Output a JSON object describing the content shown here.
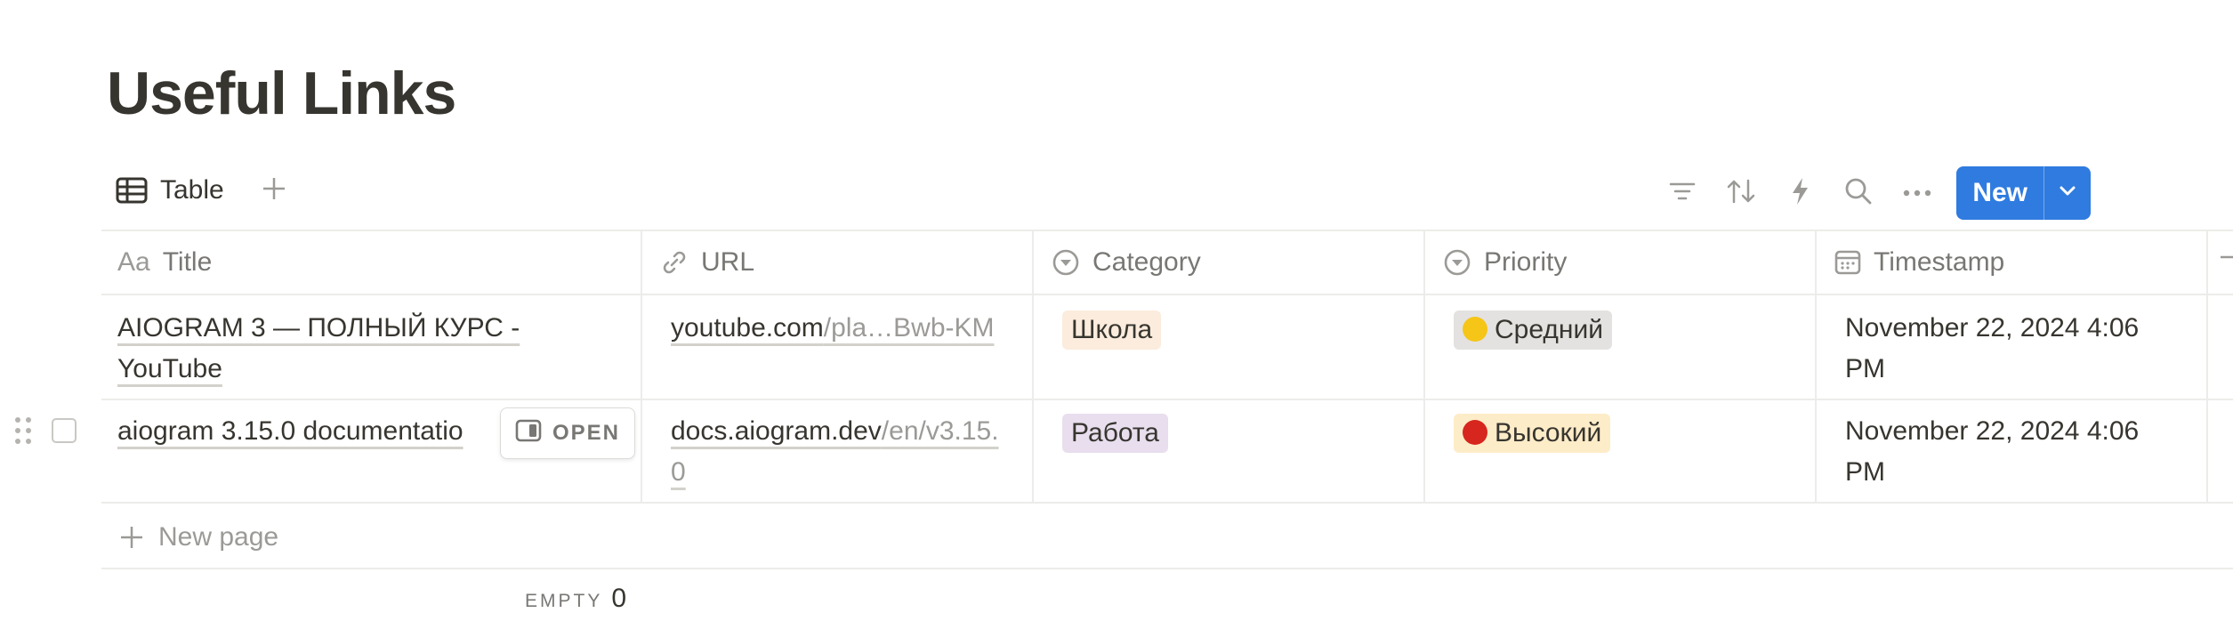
{
  "page": {
    "title": "Useful Links"
  },
  "viewbar": {
    "tab_label": "Table",
    "new_label": "New",
    "icons": [
      "filter-icon",
      "sort-icon",
      "lightning-icon",
      "search-icon",
      "more-icon"
    ]
  },
  "columns": [
    {
      "label": "Title",
      "icon": "title-aa-icon"
    },
    {
      "label": "URL",
      "icon": "link-icon"
    },
    {
      "label": "Category",
      "icon": "select-icon"
    },
    {
      "label": "Priority",
      "icon": "select-icon"
    },
    {
      "label": "Timestamp",
      "icon": "calendar-icon"
    }
  ],
  "column_title_prefix": "Aa",
  "rows": [
    {
      "title_line1": "AIOGRAM 3 — ПОЛНЫЙ КУРС -",
      "title_line2": "YouTube",
      "url_main": "youtube.com",
      "url_rest": "/pla…Bwb-KM",
      "category": "Школа",
      "priority": "Средний",
      "timestamp_line1": "November 22, 2024 4:06",
      "timestamp_line2": "PM"
    },
    {
      "title_line1": "aiogram 3.15.0 documentatio",
      "url_main": "docs.aiogram.dev",
      "url_rest": "/en/v3.15.",
      "url_rest2": "0",
      "category": "Работа",
      "priority": "Высокий",
      "timestamp_line1": "November 22, 2024 4:06",
      "timestamp_line2": "PM",
      "open_label": "OPEN"
    }
  ],
  "new_page_label": "New page",
  "calculation": {
    "label": "EMPTY",
    "value": "0"
  },
  "colors": {
    "accent": "#2f7be0",
    "tag_school": "#fbecdd",
    "tag_work": "#e8deee",
    "tag_medium": "#e3e2e0",
    "tag_high": "#fdecc8",
    "dot_yellow": "#f5c518",
    "dot_red": "#d7261e"
  }
}
